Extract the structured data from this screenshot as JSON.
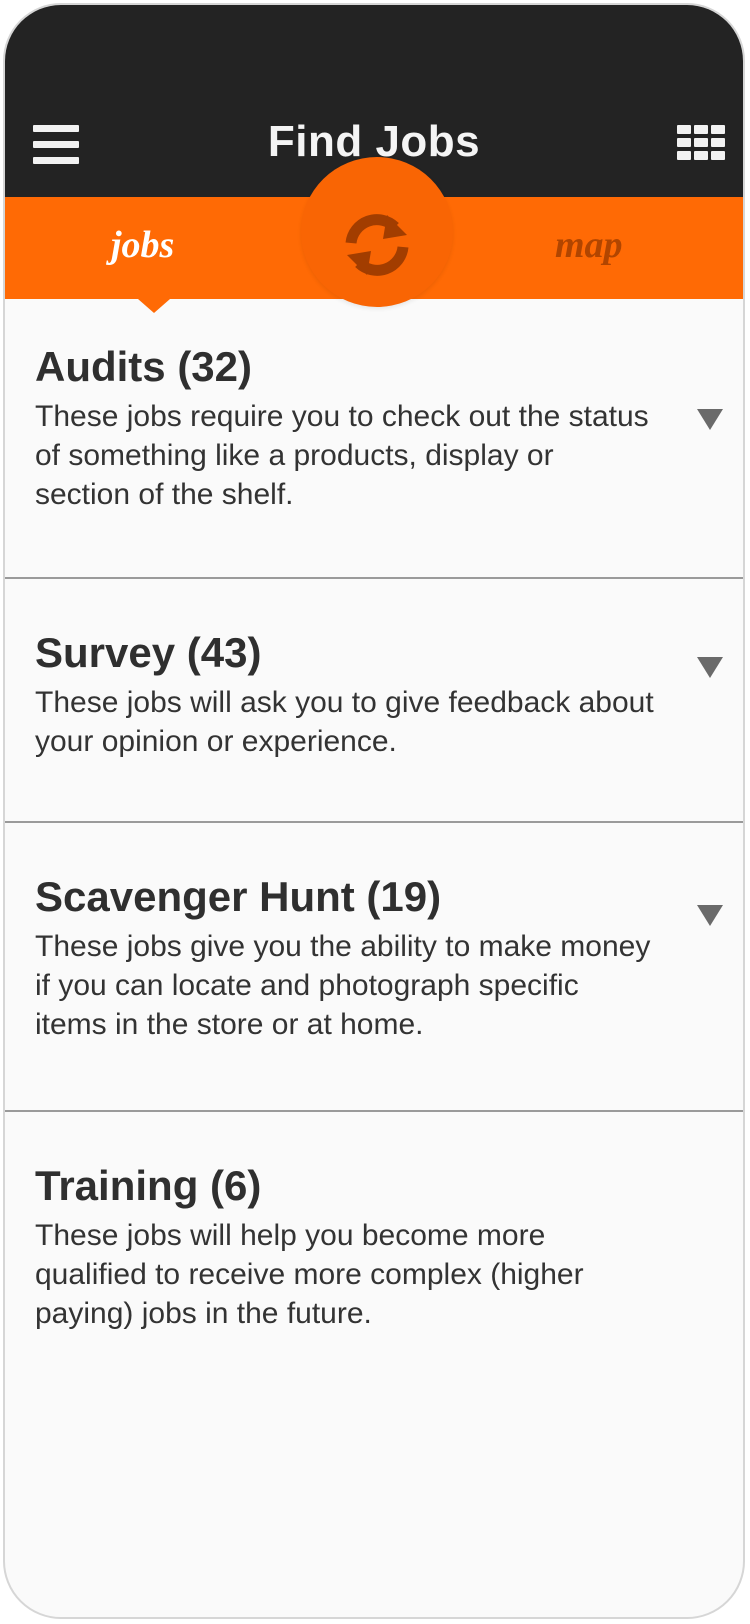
{
  "header": {
    "title": "Find Jobs",
    "menu_icon": "hamburger-menu-icon",
    "grid_icon": "grid-list-icon",
    "background_color": "#232323"
  },
  "view_toggle": {
    "left_tab": "jobs",
    "right_tab": "map",
    "center_icon": "refresh-icon",
    "selected": "jobs",
    "accent_color": "#ff6a05"
  },
  "categories": [
    {
      "title": "Audits (32)",
      "description": "These jobs require you to check out the status of something like a products, display or section of the shelf.",
      "expandable": true
    },
    {
      "title": "Survey (43)",
      "description": "These jobs will ask you to give feedback about your opinion or experience.",
      "expandable": true
    },
    {
      "title": "Scavenger Hunt (19)",
      "description": "These jobs give you the ability to make money if you can locate and photograph specific items in the store or at home.",
      "expandable": true
    },
    {
      "title": "Training (6)",
      "description": "These jobs will help you become more qualified to receive more complex (higher paying) jobs in the future.",
      "expandable": false
    }
  ]
}
